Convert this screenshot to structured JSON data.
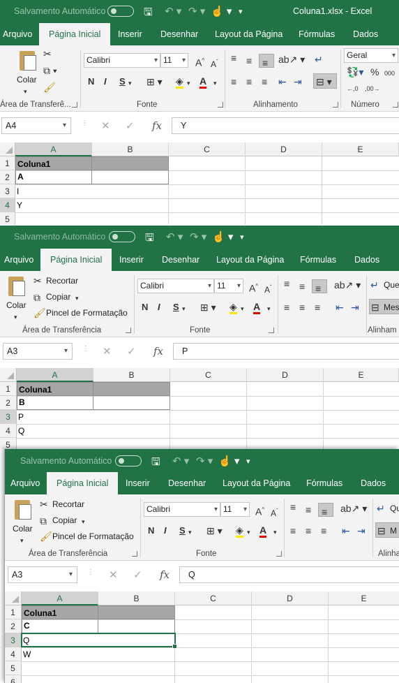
{
  "app": {
    "autosave_label": "Salvamento Automático",
    "doc_title": "Coluna1.xlsx  -  Excel",
    "tabs": [
      "Arquivo",
      "Página Inicial",
      "Inserir",
      "Desenhar",
      "Layout da Página",
      "Fórmulas",
      "Dados"
    ],
    "active_tab": "Página Inicial"
  },
  "ribbon": {
    "paste": "Colar",
    "cut": "Recortar",
    "copy": "Copiar",
    "format_painter": "Pincel de Formatação",
    "clipboard_group_full": "Área de Transferência",
    "clipboard_group_truncated": "Área de Transferê...",
    "font_name": "Calibri",
    "font_size": "11",
    "bold": "N",
    "italic": "I",
    "underline": "S",
    "font_group": "Fonte",
    "alignment_group": "Alinhamento",
    "alignment_group_truncated": "Alinham",
    "number_format": "Geral",
    "number_group": "Número",
    "wrap_text_truncated": "Que",
    "merge_truncated": "Mes",
    "merge_truncated2": "M"
  },
  "formula_bar": {
    "fx": "fx",
    "cancel": "✕",
    "enter": "✓"
  },
  "columns": [
    "A",
    "B",
    "C",
    "D",
    "E"
  ],
  "snapshots": [
    {
      "name_box": "A4",
      "formula": "Y",
      "rows": [
        "1",
        "2",
        "3",
        "4",
        "5"
      ],
      "cells": {
        "header": "Coluna1",
        "a2": "A",
        "a3": "I",
        "a4": "Y"
      }
    },
    {
      "name_box": "A3",
      "formula": "P",
      "rows": [
        "1",
        "2",
        "3",
        "4",
        "5"
      ],
      "cells": {
        "header": "Coluna1",
        "a2": "B",
        "a3": "P",
        "a4": "Q"
      }
    },
    {
      "name_box": "A3",
      "formula": "Q",
      "rows": [
        "1",
        "2",
        "3",
        "4",
        "5",
        "6"
      ],
      "cells": {
        "header": "Coluna1",
        "a2": "C",
        "a3": "Q",
        "a4": "W"
      }
    }
  ]
}
